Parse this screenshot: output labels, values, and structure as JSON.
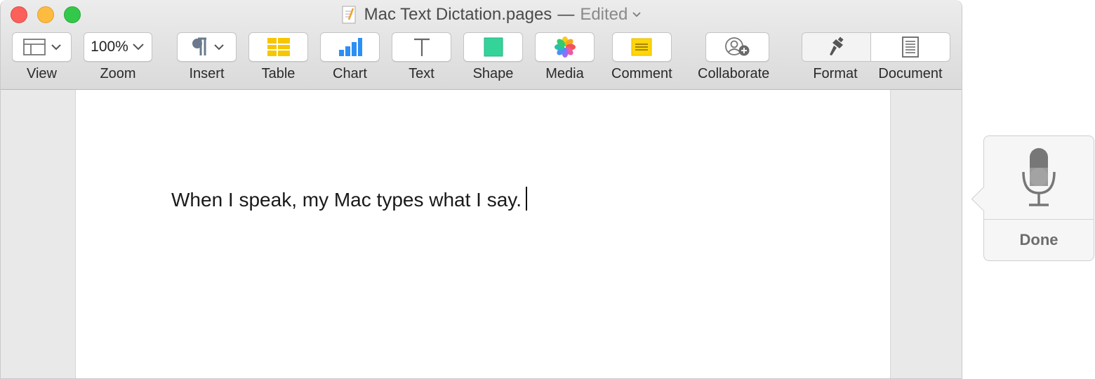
{
  "window": {
    "title": "Mac Text Dictation.pages",
    "title_separator": "—",
    "title_status": "Edited"
  },
  "toolbar": {
    "view": {
      "label": "View",
      "icon": "sidebar-view-icon"
    },
    "zoom": {
      "label": "Zoom",
      "value": "100%"
    },
    "insert": {
      "label": "Insert",
      "icon": "pilcrow-icon"
    },
    "table": {
      "label": "Table",
      "icon": "table-icon"
    },
    "chart": {
      "label": "Chart",
      "icon": "bar-chart-icon"
    },
    "text": {
      "label": "Text",
      "icon": "text-box-icon"
    },
    "shape": {
      "label": "Shape",
      "icon": "square-shape-icon"
    },
    "media": {
      "label": "Media",
      "icon": "photos-flower-icon"
    },
    "comment": {
      "label": "Comment",
      "icon": "sticky-note-icon"
    },
    "collaborate": {
      "label": "Collaborate",
      "icon": "add-person-icon"
    },
    "format": {
      "label": "Format",
      "icon": "paintbrush-icon"
    },
    "document": {
      "label": "Document",
      "icon": "document-icon"
    }
  },
  "document": {
    "body_text": "When I speak, my Mac types what I say."
  },
  "dictation": {
    "done_label": "Done",
    "icon": "microphone-icon"
  },
  "colors": {
    "table_yellow": "#f7c600",
    "chart_blue": "#2b8ff5",
    "shape_green": "#34d399",
    "comment_yellow": "#ffd60a",
    "close": "#fc605b",
    "minimize": "#fdbc40",
    "maximize": "#34c84a"
  }
}
